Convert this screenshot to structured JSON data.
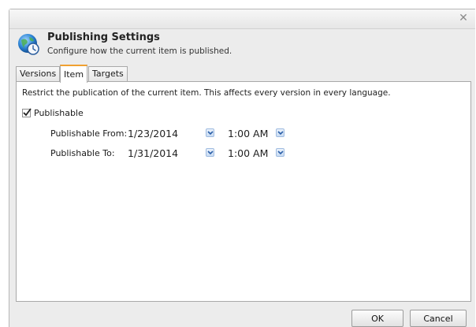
{
  "dialog": {
    "title": "Publishing Settings",
    "subtitle": "Configure how the current item is published.",
    "close_icon": "close-icon",
    "app_icon": "globe-clock-icon"
  },
  "tabs": [
    {
      "label": "Versions",
      "active": false
    },
    {
      "label": "Item",
      "active": true
    },
    {
      "label": "Targets",
      "active": false
    }
  ],
  "panel": {
    "description": "Restrict the publication of the current item. This affects every version in every language.",
    "publishable": {
      "label": "Publishable",
      "checked": true
    },
    "publishable_from": {
      "label": "Publishable From:",
      "date": "1/23/2014",
      "time": "1:00 AM"
    },
    "publishable_to": {
      "label": "Publishable To:",
      "date": "1/31/2014",
      "time": "1:00 AM"
    }
  },
  "buttons": {
    "ok": "OK",
    "cancel": "Cancel"
  },
  "colors": {
    "active_tab_accent": "#f0a030",
    "dropdown_button": "#c9dcf3"
  }
}
